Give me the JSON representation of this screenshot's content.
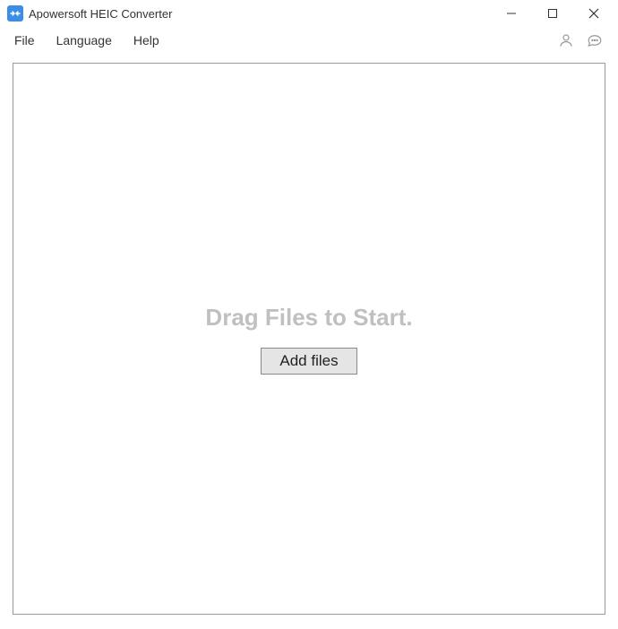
{
  "titlebar": {
    "title": "Apowersoft HEIC Converter"
  },
  "menubar": {
    "items": [
      {
        "label": "File"
      },
      {
        "label": "Language"
      },
      {
        "label": "Help"
      }
    ]
  },
  "main": {
    "drag_text": "Drag Files to Start.",
    "add_files_label": "Add files"
  }
}
